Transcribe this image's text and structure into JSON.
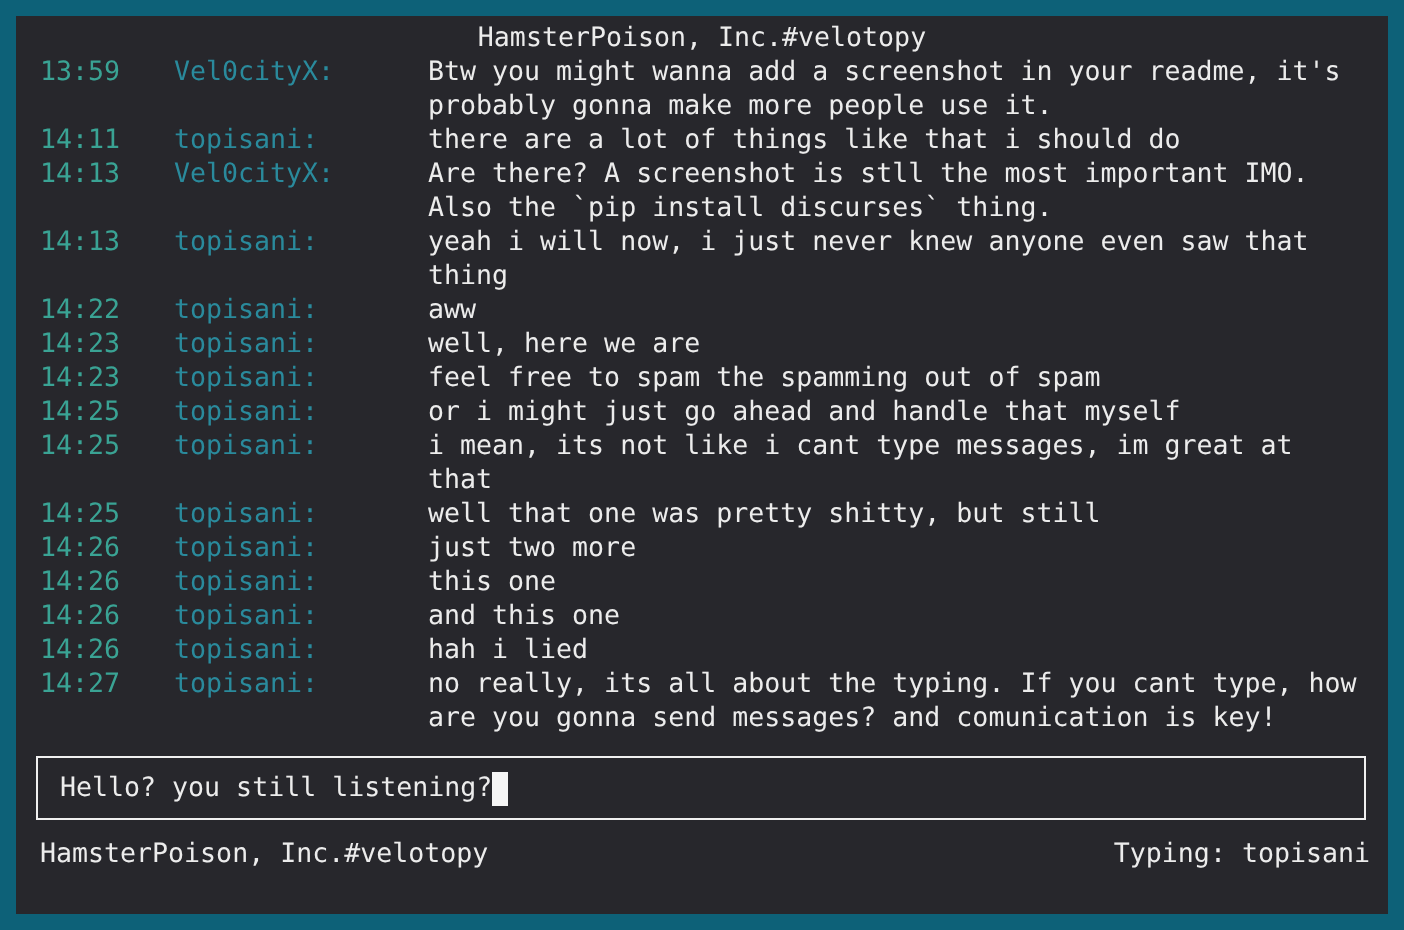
{
  "window": {
    "title": "HamsterPoison, Inc.#velotopy"
  },
  "messages": [
    {
      "time": "13:59",
      "nick": "Vel0cityX:",
      "text": "Btw you might wanna add a screenshot in your readme, it's probably gonna make more people use it."
    },
    {
      "time": "14:11",
      "nick": "topisani:",
      "text": "there are a lot of things like that i should do"
    },
    {
      "time": "14:13",
      "nick": "Vel0cityX:",
      "text": "Are there? A screenshot is stll the most important IMO. Also the `pip install discurses` thing."
    },
    {
      "time": "14:13",
      "nick": "topisani:",
      "text": "yeah i will now, i just never knew anyone even saw that thing"
    },
    {
      "time": "14:22",
      "nick": "topisani:",
      "text": "aww"
    },
    {
      "time": "14:23",
      "nick": "topisani:",
      "text": "well, here we are"
    },
    {
      "time": "14:23",
      "nick": "topisani:",
      "text": "feel free to spam the spamming out of spam"
    },
    {
      "time": "14:25",
      "nick": "topisani:",
      "text": "or i might just go ahead and handle that myself"
    },
    {
      "time": "14:25",
      "nick": "topisani:",
      "text": "i mean, its not like i cant type messages, im great at that"
    },
    {
      "time": "14:25",
      "nick": "topisani:",
      "text": "well that one was pretty shitty, but still"
    },
    {
      "time": "14:26",
      "nick": "topisani:",
      "text": "just two more"
    },
    {
      "time": "14:26",
      "nick": "topisani:",
      "text": "this one"
    },
    {
      "time": "14:26",
      "nick": "topisani:",
      "text": "and this one"
    },
    {
      "time": "14:26",
      "nick": "topisani:",
      "text": "hah i lied"
    },
    {
      "time": "14:27",
      "nick": "topisani:",
      "text": "no really, its all about the typing. If you cant type, how are you gonna send messages? and comunication is key!"
    }
  ],
  "input": {
    "value": "Hello? you still listening?"
  },
  "status_bar": {
    "channel": "HamsterPoison, Inc.#velotopy",
    "typing": "Typing: topisani"
  }
}
